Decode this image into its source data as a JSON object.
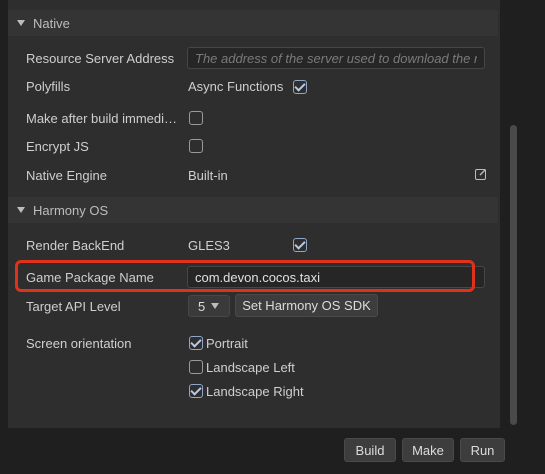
{
  "native": {
    "header": "Native",
    "resource_server_label": "Resource Server Address",
    "resource_server_placeholder": "The address of the server used to download the remo",
    "polyfills_label": "Polyfills",
    "polyfills_value": "Async Functions",
    "make_after_build_label": "Make after build immedia...",
    "encrypt_js_label": "Encrypt JS",
    "native_engine_label": "Native Engine",
    "native_engine_value": "Built-in"
  },
  "harmony": {
    "header": "Harmony OS",
    "render_backend_label": "Render BackEnd",
    "render_backend_value": "GLES3",
    "game_package_label": "Game Package Name",
    "game_package_value": "com.devon.cocos.taxi",
    "target_api_label": "Target API Level",
    "target_api_value": "5",
    "set_sdk_label": "Set Harmony OS SDK",
    "screen_orientation_label": "Screen orientation",
    "portrait_label": "Portrait",
    "landscape_left_label": "Landscape Left",
    "landscape_right_label": "Landscape Right"
  },
  "footer": {
    "build_label": "Build",
    "make_label": "Make",
    "run_label": "Run"
  },
  "state": {
    "polyfills_checked": true,
    "make_after_build_checked": false,
    "encrypt_js_checked": false,
    "render_backend_checked": true,
    "portrait_checked": true,
    "landscape_left_checked": false,
    "landscape_right_checked": true
  },
  "colors": {
    "highlight": "#e0321b",
    "panel": "#2e2e2e",
    "background": "#1f1f1f"
  },
  "icons": {
    "section_toggle": "triangle-down-icon",
    "edit": "edit-icon",
    "checkmark": "checkmark-icon",
    "dropdown": "caret-down-icon"
  }
}
